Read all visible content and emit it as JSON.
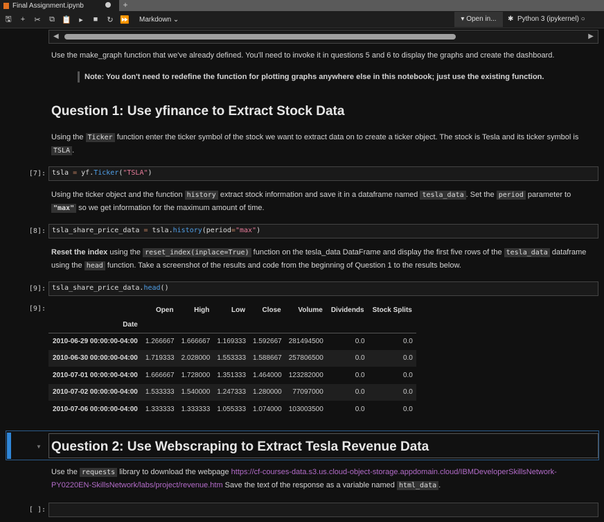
{
  "tab": {
    "title": "Final Assignment.ipynb"
  },
  "toolbar": {
    "cell_type": "Markdown",
    "open_in": "Open in...",
    "kernel": "Python 3 (ipykernel)"
  },
  "notebook": {
    "intro": "Use the make_graph function that we've already defined. You'll need to invoke it in questions 5 and 6 to display the graphs and create the dashboard.",
    "note": "Note: You don't need to redefine the function for plotting graphs anywhere else in this notebook; just use the existing function.",
    "q1_heading": "Question 1: Use yfinance to Extract Stock Data",
    "q1_p1": {
      "a": "Using the ",
      "c1": "Ticker",
      "b": " function enter the ticker symbol of the stock we want to extract data on to create a ticker object. The stock is Tesla and its ticker symbol is ",
      "c2": "TSLA",
      "d": "."
    },
    "cell7": {
      "prompt": "[7]:",
      "var": "tsla",
      "op": " = ",
      "obj": "yf.",
      "fn": "Ticker",
      "open": "(",
      "str": "\"TSLA\"",
      "close": ")"
    },
    "q1_p2": {
      "a": "Using the ticker object and the function ",
      "c1": "history",
      "b": " extract stock information and save it in a dataframe named ",
      "c2": "tesla_data",
      "c": ". Set the ",
      "c3": "period",
      "d": " parameter to ",
      "c4": "\"max\"",
      "e": " so we get information for the maximum amount of time."
    },
    "cell8": {
      "prompt": "[8]:",
      "var": "tsla_share_price_data",
      "op": " = ",
      "obj": "tsla.",
      "fn": "history",
      "open": "(period",
      "eq": "=",
      "str": "\"max\"",
      "close": ")"
    },
    "q1_p3": {
      "bold": "Reset the index",
      "a": " using the ",
      "c1": "reset_index(inplace=True)",
      "b": " function on the tesla_data DataFrame and display the first five rows of the ",
      "c2": "tesla_data",
      "c": " dataframe using the ",
      "c3": "head",
      "d": " function. Take a screenshot of the results and code from the beginning of Question 1 to the results below."
    },
    "cell9": {
      "prompt": "[9]:",
      "obj": "tsla_share_price_data.",
      "fn": "head",
      "call": "()",
      "out_prompt": "[9]:"
    },
    "table": {
      "columns": [
        "Open",
        "High",
        "Low",
        "Close",
        "Volume",
        "Dividends",
        "Stock Splits"
      ],
      "index_name": "Date",
      "rows": [
        [
          "2010-06-29 00:00:00-04:00",
          "1.266667",
          "1.666667",
          "1.169333",
          "1.592667",
          "281494500",
          "0.0",
          "0.0"
        ],
        [
          "2010-06-30 00:00:00-04:00",
          "1.719333",
          "2.028000",
          "1.553333",
          "1.588667",
          "257806500",
          "0.0",
          "0.0"
        ],
        [
          "2010-07-01 00:00:00-04:00",
          "1.666667",
          "1.728000",
          "1.351333",
          "1.464000",
          "123282000",
          "0.0",
          "0.0"
        ],
        [
          "2010-07-02 00:00:00-04:00",
          "1.533333",
          "1.540000",
          "1.247333",
          "1.280000",
          "77097000",
          "0.0",
          "0.0"
        ],
        [
          "2010-07-06 00:00:00-04:00",
          "1.333333",
          "1.333333",
          "1.055333",
          "1.074000",
          "103003500",
          "0.0",
          "0.0"
        ]
      ]
    },
    "q2_heading": "Question 2: Use Webscraping to Extract Tesla Revenue Data",
    "q2_p": {
      "a": "Use the ",
      "c1": "requests",
      "b": " library to download the webpage ",
      "link": "https://cf-courses-data.s3.us.cloud-object-storage.appdomain.cloud/IBMDeveloperSkillsNetwork-PY0220EN-SkillsNetwork/labs/project/revenue.htm",
      "c": " Save the text of the response as a variable named ",
      "c2": "html_data",
      "d": "."
    },
    "empty_prompt": "[ ]:"
  },
  "colors": {
    "accent": "#2f86d8",
    "link": "#b36cc9",
    "function": "#4f9fe8",
    "string": "#e87b9a"
  }
}
